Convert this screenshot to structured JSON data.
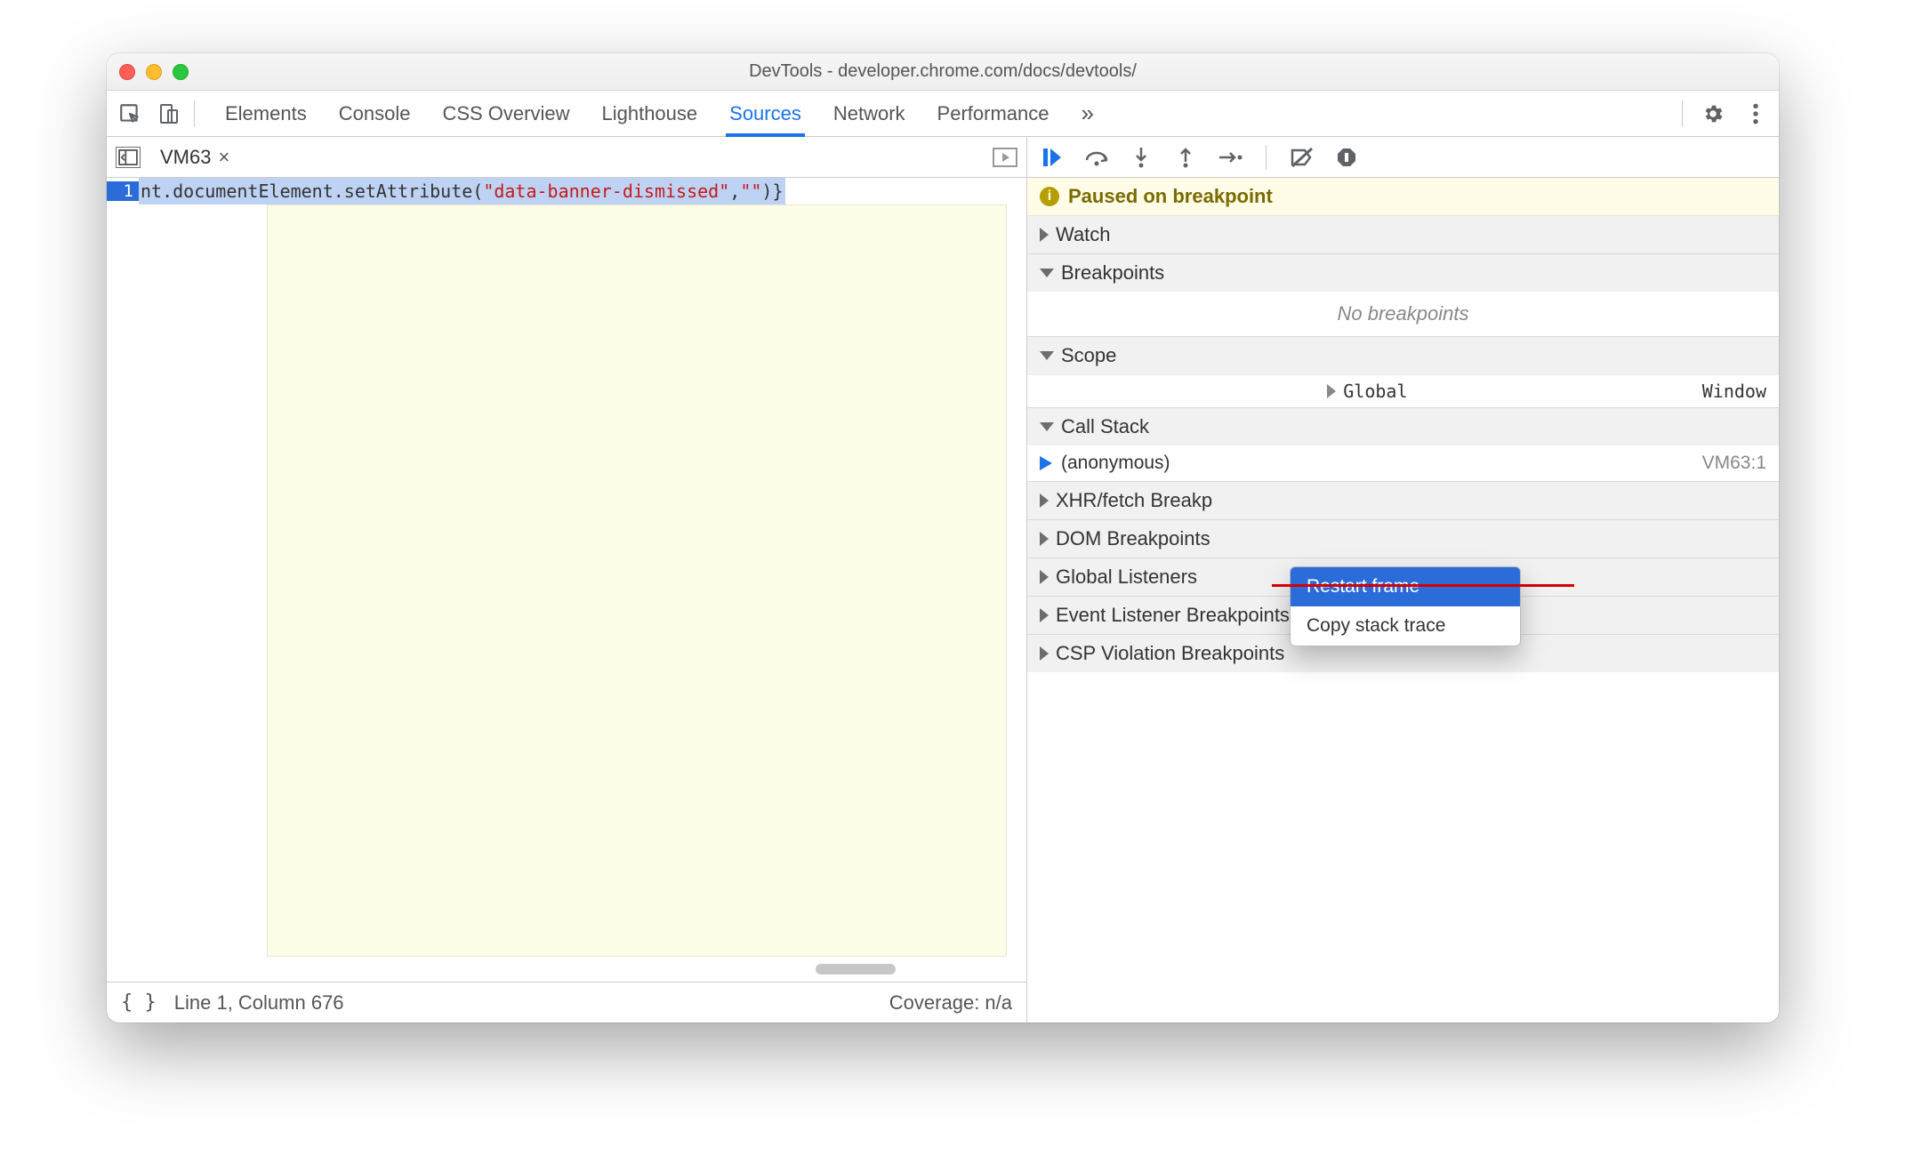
{
  "window": {
    "title": "DevTools - developer.chrome.com/docs/devtools/"
  },
  "toolbar": {
    "tabs": [
      "Elements",
      "Console",
      "CSS Overview",
      "Lighthouse",
      "Sources",
      "Network",
      "Performance"
    ],
    "active_tab": "Sources",
    "more_tabs_glyph": "»"
  },
  "editor": {
    "tab_name": "VM63",
    "line_number": "1",
    "code_prefix": "nt.documentElement.setAttribute(",
    "code_string": "\"data-banner-dismissed\"",
    "code_mid": ",",
    "code_string2": "\"\"",
    "code_suffix": ")}",
    "status_line": "Line 1, Column 676",
    "coverage": "Coverage: n/a",
    "pretty_print_glyph": "{ }"
  },
  "debugger": {
    "paused_label": "Paused on breakpoint",
    "sections": {
      "watch": "Watch",
      "breakpoints": "Breakpoints",
      "no_breakpoints": "No breakpoints",
      "scope": "Scope",
      "global": "Global",
      "global_value": "Window",
      "call_stack": "Call Stack",
      "anonymous": "(anonymous)",
      "anonymous_loc": "VM63:1",
      "xhr": "XHR/fetch Breakp",
      "dom": "DOM Breakpoints",
      "listeners": "Global Listeners",
      "event": "Event Listener Breakpoints",
      "csp": "CSP Violation Breakpoints"
    }
  },
  "context_menu": {
    "restart": "Restart frame",
    "copy": "Copy stack trace"
  }
}
